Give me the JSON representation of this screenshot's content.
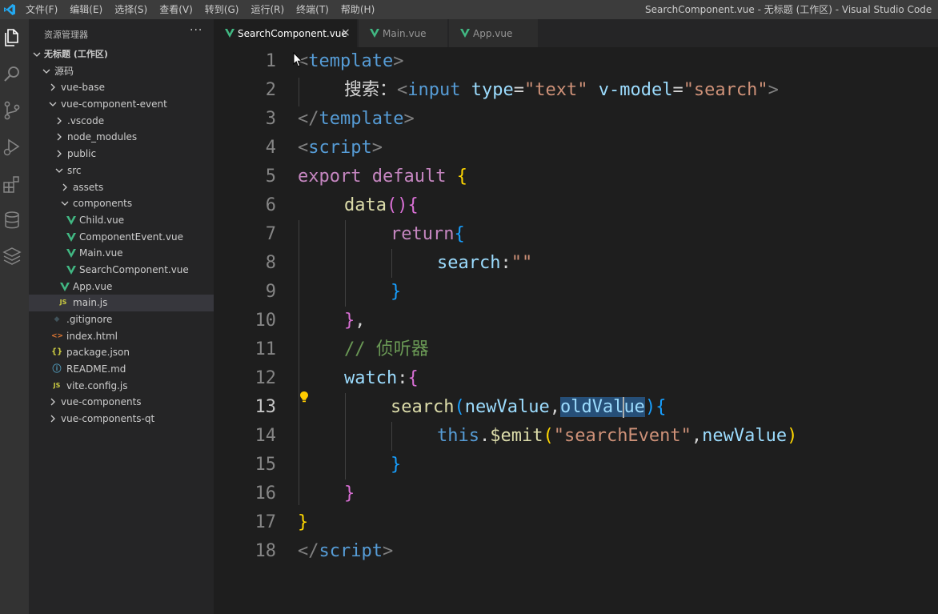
{
  "menu": [
    "文件(F)",
    "编辑(E)",
    "选择(S)",
    "查看(V)",
    "转到(G)",
    "运行(R)",
    "终端(T)",
    "帮助(H)"
  ],
  "window_title": "SearchComponent.vue - 无标题 (工作区) - Visual Studio Code",
  "explorer": {
    "title": "资源管理器",
    "more": "···",
    "workspace": "无标题 (工作区)",
    "items": [
      {
        "label": "源码",
        "expanded": true
      },
      {
        "label": "vue-base",
        "expanded": false
      },
      {
        "label": "vue-component-event",
        "expanded": true
      },
      {
        "label": ".vscode",
        "expanded": false
      },
      {
        "label": "node_modules",
        "expanded": false
      },
      {
        "label": "public",
        "expanded": false
      },
      {
        "label": "src",
        "expanded": true
      },
      {
        "label": "assets",
        "expanded": false
      },
      {
        "label": "components",
        "expanded": true
      },
      {
        "label": "Child.vue"
      },
      {
        "label": "ComponentEvent.vue"
      },
      {
        "label": "Main.vue"
      },
      {
        "label": "SearchComponent.vue"
      },
      {
        "label": "App.vue"
      },
      {
        "label": "main.js",
        "icon_text": "JS"
      },
      {
        "label": ".gitignore",
        "icon_text": "◆"
      },
      {
        "label": "index.html",
        "icon_text": "<>"
      },
      {
        "label": "package.json",
        "icon_text": "{}"
      },
      {
        "label": "README.md",
        "icon_text": "ⓘ"
      },
      {
        "label": "vite.config.js",
        "icon_text": "JS"
      },
      {
        "label": "vue-components",
        "expanded": false
      },
      {
        "label": "vue-components-qt",
        "expanded": false
      }
    ]
  },
  "tabs": [
    {
      "label": "SearchComponent.vue",
      "active": true,
      "close": "×"
    },
    {
      "label": "Main.vue",
      "active": false
    },
    {
      "label": "App.vue",
      "active": false
    }
  ],
  "line_numbers": [
    "1",
    "2",
    "3",
    "4",
    "5",
    "6",
    "7",
    "8",
    "9",
    "10",
    "11",
    "12",
    "13",
    "14",
    "15",
    "16",
    "17",
    "18"
  ],
  "code": {
    "l1": [
      "<",
      "template",
      ">"
    ],
    "l2": [
      "搜索：",
      "<",
      "input",
      "type",
      "=",
      "\"text\"",
      "v-model",
      "=",
      "\"search\"",
      ">"
    ],
    "l3": [
      "</",
      "template",
      ">"
    ],
    "l4": [
      "<",
      "script",
      ">"
    ],
    "l5": [
      "export",
      "default",
      "{"
    ],
    "l6": [
      "data",
      "(",
      ")",
      "{"
    ],
    "l7": [
      "return",
      "{"
    ],
    "l8": [
      "search",
      ":",
      "\"\""
    ],
    "l9": [
      "}"
    ],
    "l10": [
      "}",
      ","
    ],
    "l11": [
      "// 侦听器"
    ],
    "l12": [
      "watch",
      ":",
      "{"
    ],
    "l13": [
      "search",
      "(",
      "newValue",
      ",",
      "oldVal",
      "ue",
      ")",
      "{"
    ],
    "l14": [
      "this",
      ".",
      "$emit",
      "(",
      "\"searchEvent\"",
      ",",
      "newValue",
      ")"
    ],
    "l15": [
      "}"
    ],
    "l16": [
      "}"
    ],
    "l17": [
      "}"
    ],
    "l18": [
      "</",
      "script",
      ">"
    ]
  },
  "colors": {
    "accent": "#007acc",
    "vue_green": "#41b883",
    "js_yellow": "#cbcb41",
    "selection": "#264f78"
  }
}
